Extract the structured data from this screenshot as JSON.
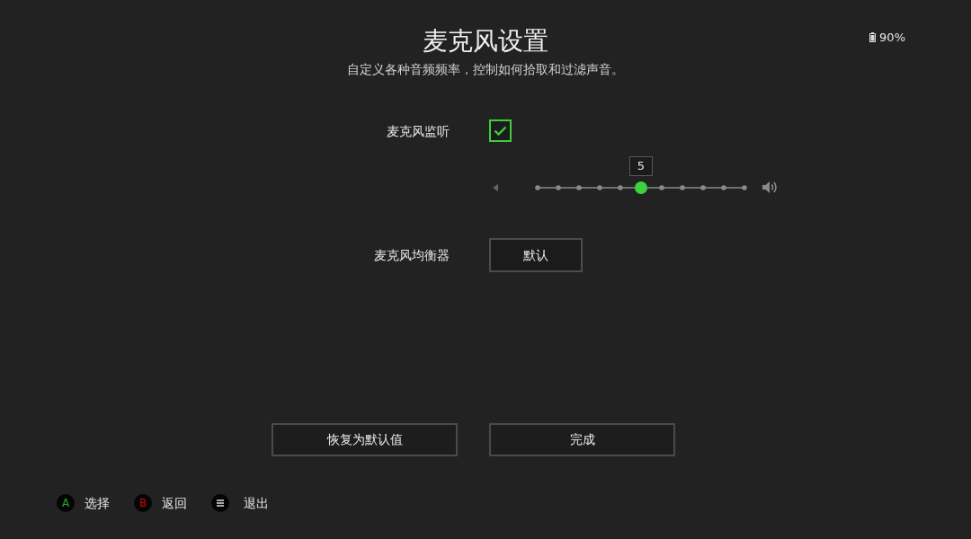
{
  "status": {
    "battery": "90%"
  },
  "header": {
    "title": "麦克风设置",
    "subtitle": "自定义各种音频频率，控制如何拾取和过滤声音。"
  },
  "settings": [
    {
      "kind": "checkbox",
      "label": "麦克风监听",
      "checked": true
    },
    {
      "kind": "slider",
      "reading": "5",
      "level": 0.5
    },
    {
      "kind": "button",
      "label": "麦克风均衡器",
      "value": "默认"
    }
  ],
  "buttons": [
    "恢复为默认值",
    "完成"
  ],
  "hints": [
    {
      "kind": "letter",
      "key": "A",
      "color": "#22b022",
      "label": "选择"
    },
    {
      "kind": "letter",
      "key": "B",
      "color": "#e00000",
      "label": "返回"
    },
    {
      "kind": "menu",
      "label": "退出"
    }
  ]
}
